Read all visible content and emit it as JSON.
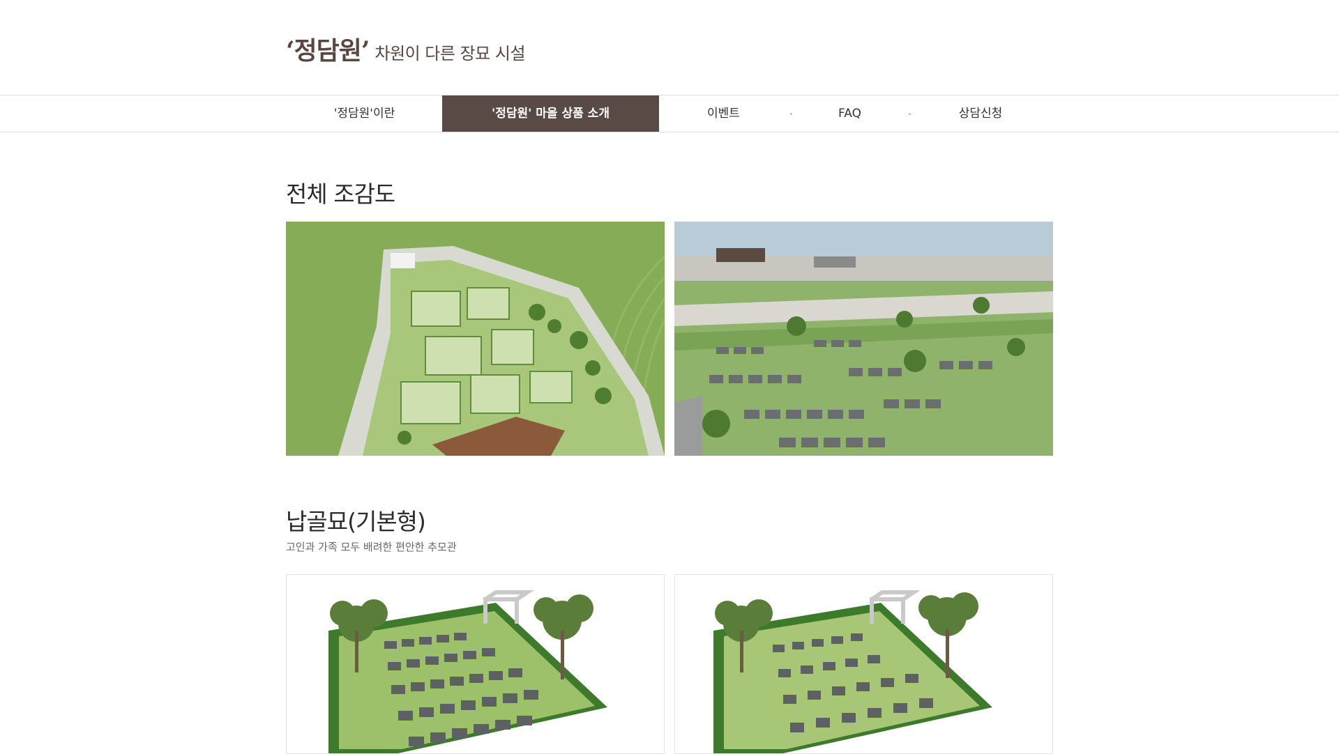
{
  "header": {
    "logo_mark": "‘정담원’",
    "logo_sub": "차원이 다른 장묘 시설"
  },
  "nav": {
    "items": [
      {
        "label": "'정담원'이란",
        "active": false
      },
      {
        "label": "'정담원' 마을 상품 소개",
        "active": true
      },
      {
        "label": "이벤트",
        "active": false
      },
      {
        "label": "FAQ",
        "active": false
      },
      {
        "label": "상담신청",
        "active": false
      }
    ]
  },
  "overview": {
    "title": "전체 조감도"
  },
  "product": {
    "title": "납골묘(기본형)",
    "subtitle": "고인과 가족 모두 배려한 편안한 추모관"
  },
  "colors": {
    "brand": "#5a463f",
    "nav_active_bg": "#5a4a45",
    "lawn_green": "#7fae55",
    "hedge_green": "#3d7a2c"
  }
}
